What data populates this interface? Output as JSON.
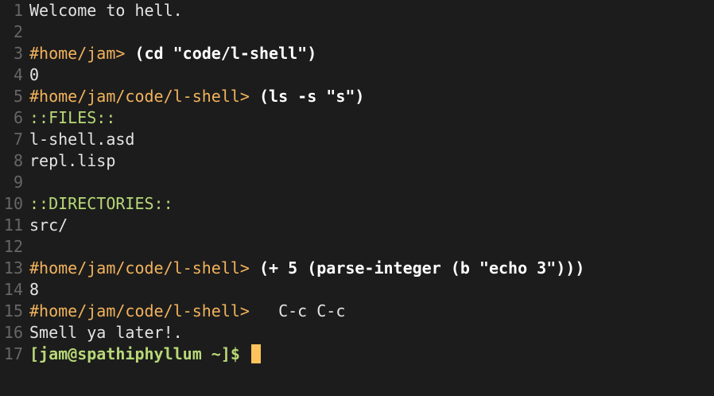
{
  "lines": [
    {
      "n": "1",
      "parts": [
        {
          "t": "Welcome to hell.",
          "c": "out"
        }
      ]
    },
    {
      "n": "2",
      "parts": []
    },
    {
      "n": "3",
      "parts": [
        {
          "t": "#home/jam> ",
          "c": "prompt"
        },
        {
          "t": "(cd \"code/l-shell\")",
          "c": "cmd"
        }
      ]
    },
    {
      "n": "4",
      "parts": [
        {
          "t": "0",
          "c": "out"
        }
      ]
    },
    {
      "n": "5",
      "parts": [
        {
          "t": "#home/jam/code/l-shell> ",
          "c": "prompt"
        },
        {
          "t": "(ls -s \"s\")",
          "c": "cmd"
        }
      ]
    },
    {
      "n": "6",
      "parts": [
        {
          "t": "::FILES::",
          "c": "section"
        }
      ]
    },
    {
      "n": "7",
      "parts": [
        {
          "t": "l-shell.asd",
          "c": "out"
        }
      ]
    },
    {
      "n": "8",
      "parts": [
        {
          "t": "repl.lisp",
          "c": "out"
        }
      ]
    },
    {
      "n": "9",
      "parts": []
    },
    {
      "n": "10",
      "parts": [
        {
          "t": "::DIRECTORIES::",
          "c": "section"
        }
      ]
    },
    {
      "n": "11",
      "parts": [
        {
          "t": "src/",
          "c": "out"
        }
      ]
    },
    {
      "n": "12",
      "parts": []
    },
    {
      "n": "13",
      "parts": [
        {
          "t": "#home/jam/code/l-shell> ",
          "c": "prompt"
        },
        {
          "t": "(+ 5 (parse-integer (b \"echo 3\")))",
          "c": "cmd"
        }
      ]
    },
    {
      "n": "14",
      "parts": [
        {
          "t": "8",
          "c": "out"
        }
      ]
    },
    {
      "n": "15",
      "parts": [
        {
          "t": "#home/jam/code/l-shell> ",
          "c": "prompt"
        },
        {
          "t": "  C-c C-c",
          "c": "out"
        }
      ]
    },
    {
      "n": "16",
      "parts": [
        {
          "t": "Smell ya later!.",
          "c": "out"
        }
      ]
    },
    {
      "n": "17",
      "parts": [
        {
          "t": "[jam@spathiphyllum ~]$ ",
          "c": "shell-prompt"
        }
      ]
    }
  ],
  "colors": {
    "background": "#1c1c1c",
    "prompt": "#f2b35d",
    "section": "#b8d877",
    "cursor": "#ffc35c",
    "line_number": "#666666"
  }
}
